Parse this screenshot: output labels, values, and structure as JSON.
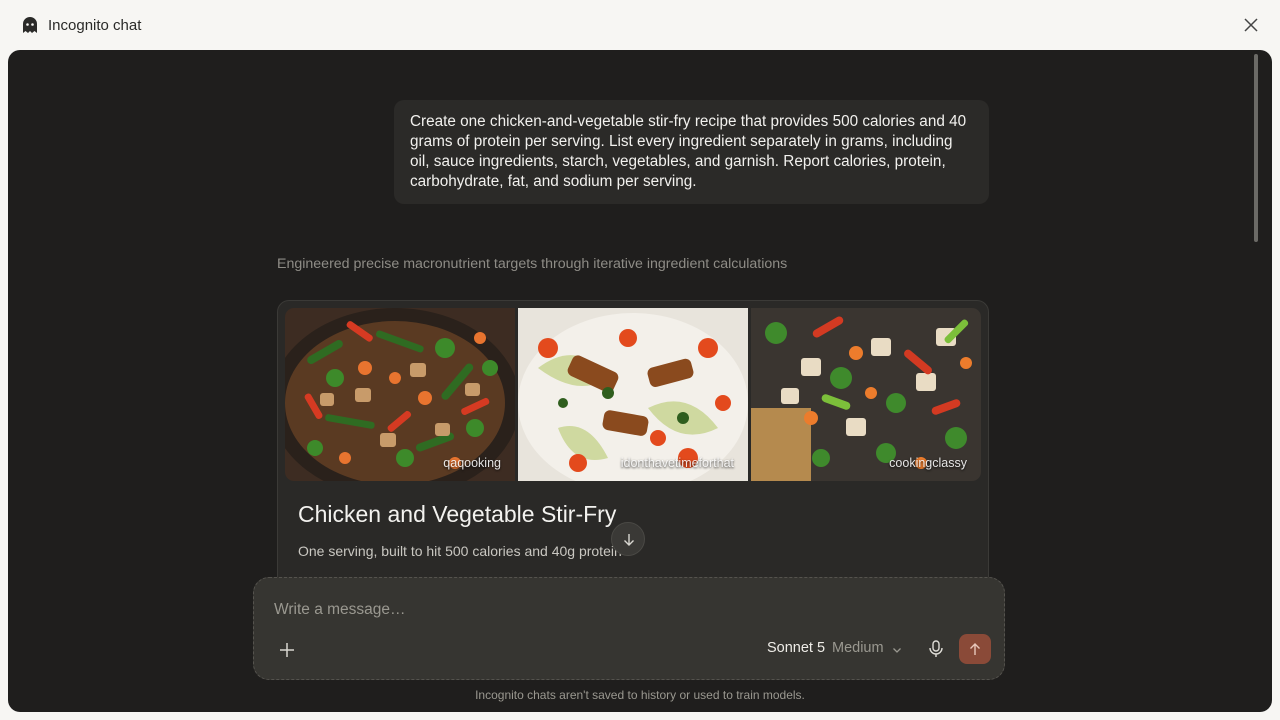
{
  "window": {
    "title": "Incognito chat"
  },
  "conversation": {
    "user_message": "Create one chicken-and-vegetable stir-fry recipe that provides 500 calories and 40 grams of protein per serving. List every ingredient separately in grams, including oil, sauce ingredients, starch, vegetables, and garnish. Report calories, protein, carbohydrate, fat, and sodium per serving.",
    "thinking_summary": "Engineered precise macronutrient targets through iterative ingredient calculations",
    "recipe_card": {
      "photo_credits": [
        "qaqooking",
        "idonthavetimeforthat",
        "cookingclassy"
      ],
      "title": "Chicken and Vegetable Stir-Fry",
      "subtitle": "One serving, built to hit 500 calories and 40g protein"
    }
  },
  "composer": {
    "placeholder": "Write a message…",
    "model": "Sonnet 5",
    "effort": "Medium"
  },
  "footer": {
    "note": "Incognito chats aren't saved to history or used to train models."
  },
  "colors": {
    "panel_bg": "#1f1e1d",
    "send_button": "#8a4a38"
  }
}
